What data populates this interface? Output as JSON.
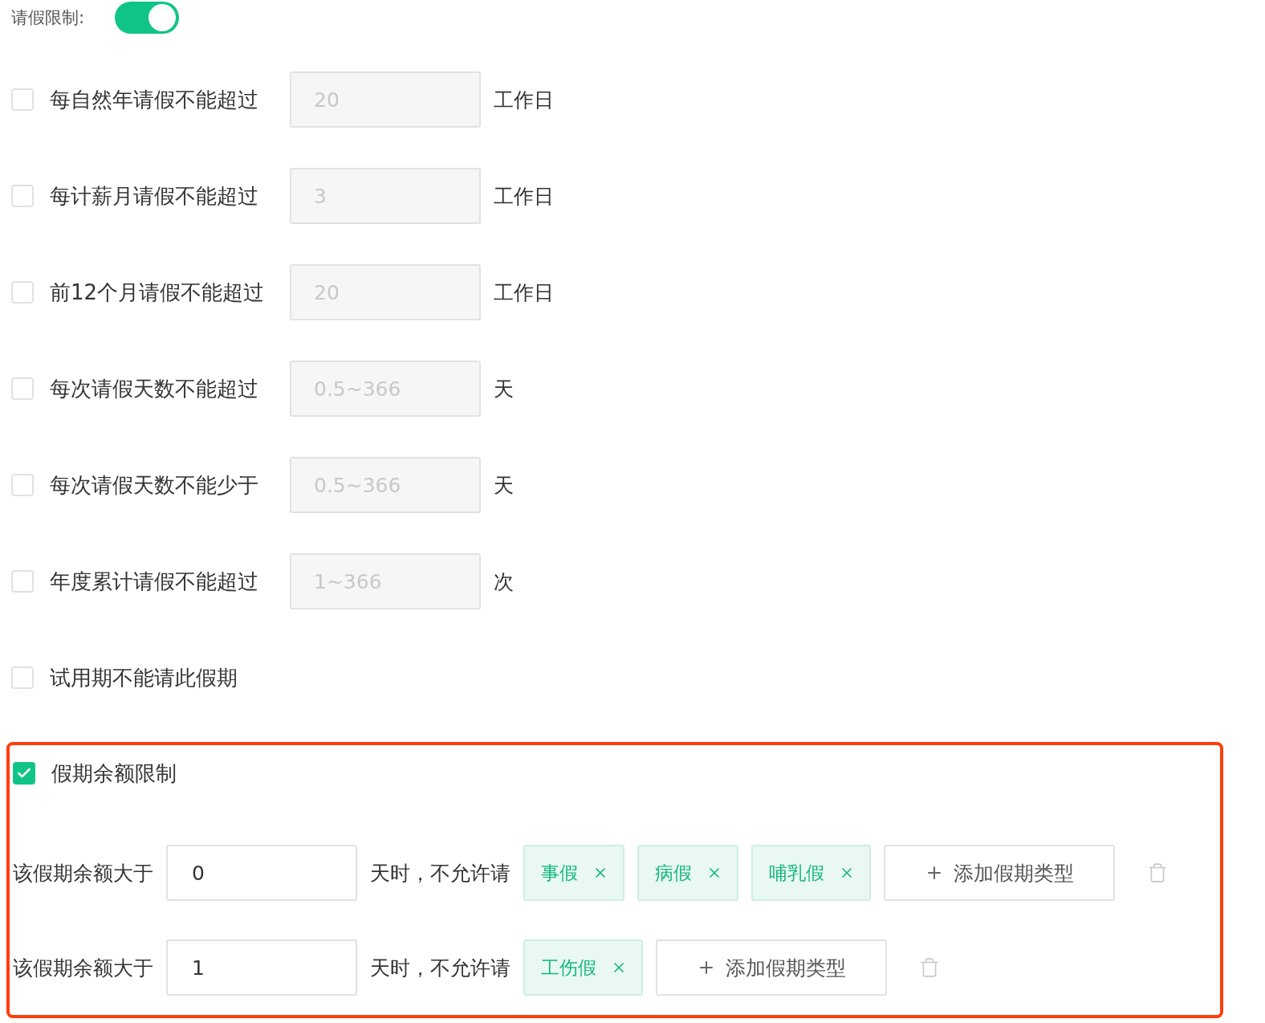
{
  "leave_limit": {
    "label": "请假限制:",
    "on": true
  },
  "limits": [
    {
      "label": "每自然年请假不能超过",
      "checked": false,
      "placeholder": "20",
      "unit": "工作日"
    },
    {
      "label": "每计薪月请假不能超过",
      "checked": false,
      "placeholder": "3",
      "unit": "工作日"
    },
    {
      "label": "前12个月请假不能超过",
      "checked": false,
      "placeholder": "20",
      "unit": "工作日"
    },
    {
      "label": "每次请假天数不能超过",
      "checked": false,
      "placeholder": "0.5~366",
      "unit": "天"
    },
    {
      "label": "每次请假天数不能少于",
      "checked": false,
      "placeholder": "0.5~366",
      "unit": "天"
    },
    {
      "label": "年度累计请假不能超过",
      "checked": false,
      "placeholder": "1~366",
      "unit": "次"
    },
    {
      "label": "试用期不能请此假期",
      "checked": false
    }
  ],
  "balance_limit": {
    "label": "假期余额限制",
    "checked": true,
    "rules": [
      {
        "prefix": "该假期余额大于",
        "value": "0",
        "suffix": "天时，不允许请",
        "tags": [
          "事假",
          "病假",
          "哺乳假"
        ],
        "add_button": "添加假期类型"
      },
      {
        "prefix": "该假期余额大于",
        "value": "1",
        "suffix": "天时，不允许请",
        "tags": [
          "工伤假"
        ],
        "add_button": "添加假期类型"
      }
    ]
  }
}
